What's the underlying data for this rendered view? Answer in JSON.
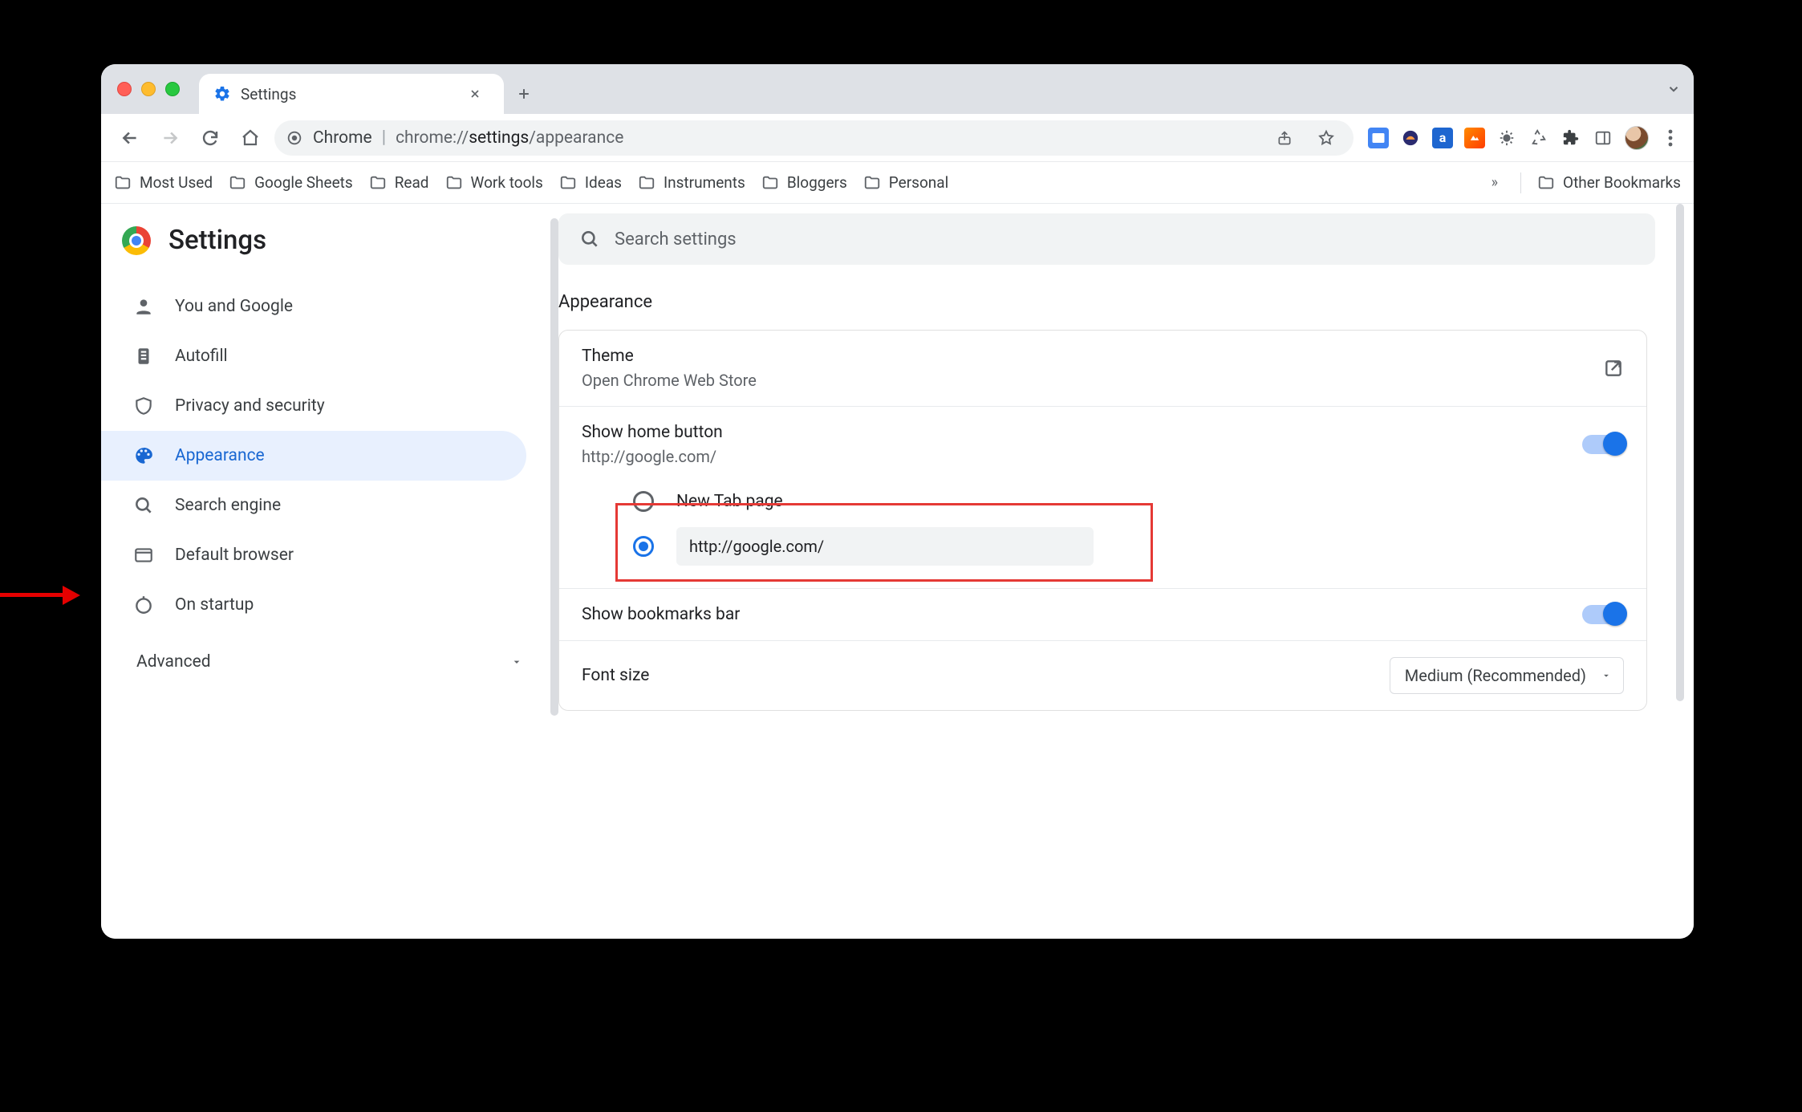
{
  "tab": {
    "title": "Settings"
  },
  "omnibox": {
    "prefix": "Chrome",
    "url_display_plain": "chrome://",
    "url_display_bold": "settings",
    "url_display_tail": "/appearance"
  },
  "bookmarks": {
    "items": [
      "Most Used",
      "Google Sheets",
      "Read",
      "Work tools",
      "Ideas",
      "Instruments",
      "Bloggers",
      "Personal"
    ],
    "other": "Other Bookmarks"
  },
  "brand": {
    "title": "Settings"
  },
  "search": {
    "placeholder": "Search settings"
  },
  "sidebar": {
    "items": [
      {
        "label": "You and Google"
      },
      {
        "label": "Autofill"
      },
      {
        "label": "Privacy and security"
      },
      {
        "label": "Appearance"
      },
      {
        "label": "Search engine"
      },
      {
        "label": "Default browser"
      },
      {
        "label": "On startup"
      }
    ],
    "advanced": "Advanced"
  },
  "section": {
    "title": "Appearance"
  },
  "rows": {
    "theme": {
      "title": "Theme",
      "sub": "Open Chrome Web Store"
    },
    "home": {
      "title": "Show home button",
      "sub": "http://google.com/",
      "opt_newtab": "New Tab page",
      "opt_custom_value": "http://google.com/"
    },
    "bookmarksbar": {
      "title": "Show bookmarks bar"
    },
    "fontsize": {
      "title": "Font size",
      "value": "Medium (Recommended)"
    }
  }
}
